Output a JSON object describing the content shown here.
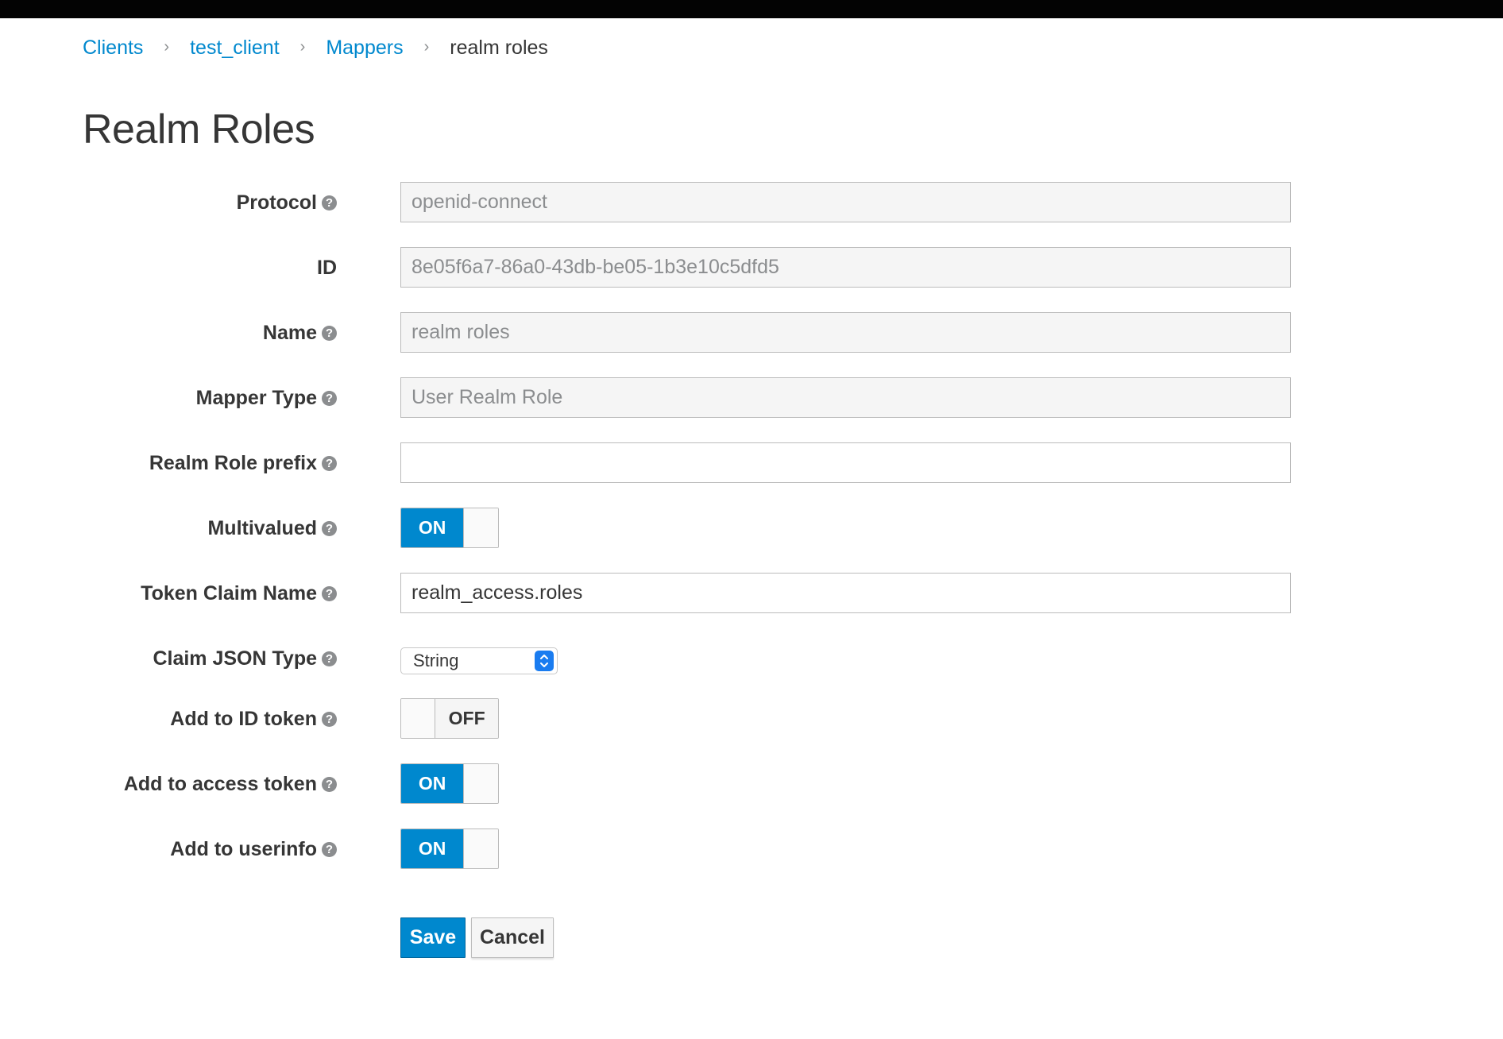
{
  "breadcrumb": {
    "items": [
      {
        "label": "Clients"
      },
      {
        "label": "test_client"
      },
      {
        "label": "Mappers"
      },
      {
        "label": "realm roles"
      }
    ],
    "separator": "›"
  },
  "page": {
    "title": "Realm Roles"
  },
  "form": {
    "help_glyph": "?",
    "protocol": {
      "label": "Protocol",
      "value": "openid-connect"
    },
    "id": {
      "label": "ID",
      "value": "8e05f6a7-86a0-43db-be05-1b3e10c5dfd5"
    },
    "name": {
      "label": "Name",
      "value": "realm roles"
    },
    "mapper_type": {
      "label": "Mapper Type",
      "value": "User Realm Role"
    },
    "realm_role_prefix": {
      "label": "Realm Role prefix",
      "value": ""
    },
    "multivalued": {
      "label": "Multivalued",
      "state": "ON"
    },
    "token_claim_name": {
      "label": "Token Claim Name",
      "value": "realm_access.roles"
    },
    "claim_json_type": {
      "label": "Claim JSON Type",
      "selected": "String"
    },
    "add_to_id_token": {
      "label": "Add to ID token",
      "state": "OFF"
    },
    "add_to_access_token": {
      "label": "Add to access token",
      "state": "ON"
    },
    "add_to_userinfo": {
      "label": "Add to userinfo",
      "state": "ON"
    }
  },
  "actions": {
    "save_label": "Save",
    "cancel_label": "Cancel"
  },
  "colors": {
    "link": "#0088ce",
    "primary": "#0088ce",
    "text": "#363636",
    "muted": "#8b8d8f"
  },
  "icons": {
    "help": "question-circle-icon",
    "select_caret": "up-down-caret-icon"
  }
}
